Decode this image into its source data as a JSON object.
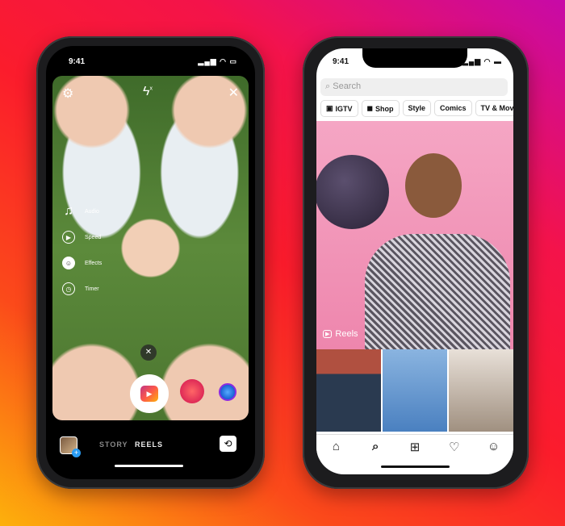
{
  "camera_phone": {
    "time": "9:41",
    "side_tools": [
      {
        "icon": "music-note-icon",
        "label": "Audio"
      },
      {
        "icon": "speed-icon",
        "label": "Speed"
      },
      {
        "icon": "effects-icon",
        "label": "Effects"
      },
      {
        "icon": "timer-icon",
        "label": "Timer"
      }
    ],
    "modes": [
      "STORY",
      "REELS"
    ],
    "active_mode": "REELS"
  },
  "explore_phone": {
    "time": "9:41",
    "search_placeholder": "Search",
    "chips": [
      {
        "icon": "igtv-icon",
        "label": "IGTV"
      },
      {
        "icon": "shop-bag-icon",
        "label": "Shop"
      },
      {
        "label": "Style"
      },
      {
        "label": "Comics"
      },
      {
        "label": "TV & Movie"
      }
    ],
    "reels_label": "Reels",
    "nav": [
      "home-icon",
      "search-icon",
      "add-icon",
      "heart-icon",
      "profile-icon"
    ]
  }
}
